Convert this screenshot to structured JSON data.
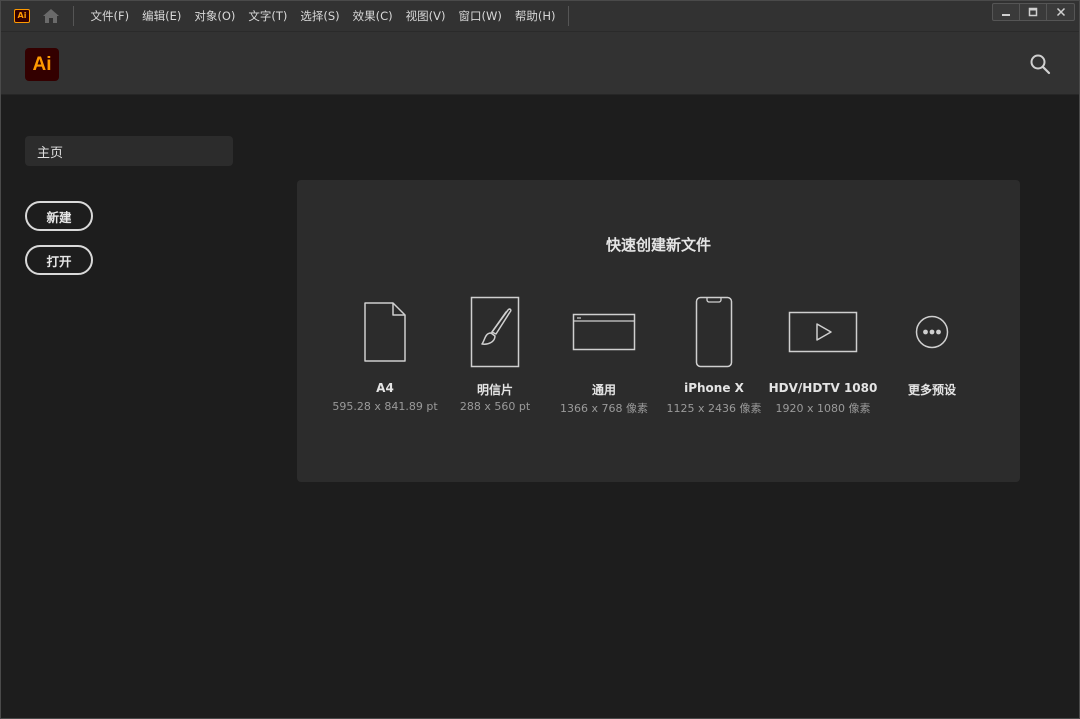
{
  "menubar": {
    "app_icon_label": "Ai",
    "items": [
      "文件(F)",
      "编辑(E)",
      "对象(O)",
      "文字(T)",
      "选择(S)",
      "效果(C)",
      "视图(V)",
      "窗口(W)",
      "帮助(H)"
    ],
    "window_controls": [
      "minimize-icon",
      "maximize-icon",
      "close-icon"
    ]
  },
  "header": {
    "logo_text": "Ai",
    "search_icon": "search-icon"
  },
  "sidebar": {
    "home_label": "主页",
    "new_label": "新建",
    "open_label": "打开"
  },
  "quick_create": {
    "title": "快速创建新文件",
    "presets": [
      {
        "name": "A4",
        "size": "595.28 x 841.89 pt",
        "icon": "document-icon"
      },
      {
        "name": "明信片",
        "size": "288 x 560 pt",
        "icon": "brush-icon"
      },
      {
        "name": "通用",
        "size": "1366 x 768 像素",
        "icon": "browser-window-icon"
      },
      {
        "name": "iPhone X",
        "size": "1125 x 2436 像素",
        "icon": "phone-icon"
      },
      {
        "name": "HDV/HDTV 1080",
        "size": "1920 x 1080 像素",
        "icon": "video-play-icon"
      },
      {
        "name": "更多预设",
        "size": "",
        "icon": "more-icon"
      }
    ]
  },
  "colors": {
    "background": "#1d1d1d",
    "panel": "#2c2c2c",
    "header": "#323232",
    "logo_bg": "#330000",
    "logo_fg": "#ff9a00"
  }
}
